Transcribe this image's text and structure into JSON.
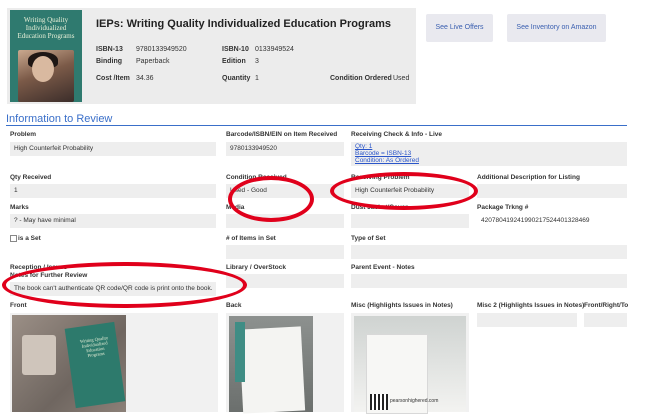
{
  "book": {
    "title": "IEPs: Writing Quality Individualized Education Programs",
    "cover_text": "Writing Quality Individualized Education Programs",
    "isbn13_label": "ISBN-13",
    "isbn13": "9780133949520",
    "isbn10_label": "ISBN-10",
    "isbn10": "0133949524",
    "binding_label": "Binding",
    "binding": "Paperback",
    "edition_label": "Edition",
    "edition": "3",
    "cost_label": "Cost /Item",
    "cost": "34.36",
    "quantity_label": "Quantity",
    "quantity": "1",
    "condition_label": "Condition Ordered",
    "condition": "Used"
  },
  "buttons": {
    "live_offers": "See Live Offers",
    "inventory": "See Inventory on Amazon"
  },
  "section": {
    "title": "Information to Review"
  },
  "fields": {
    "problem_label": "Problem",
    "problem": "High Counterfeit Probability",
    "barcode_label": "Barcode/ISBN/EIN on Item Received",
    "barcode": "9780133949520",
    "check_label": "Receiving Check & Info - Live",
    "check_qty": "Qty: 1",
    "check_barcode": "Barcode = ISBN-13",
    "check_condition": "Condition: As Ordered",
    "qty_label": "Qty Received",
    "qty": "1",
    "cond_label": "Condition Received",
    "cond": "Used - Good",
    "recv_problem_label": "Receiving Problem",
    "recv_problem": "High Counterfeit Probability",
    "addl_label": "Additional Description for Listing",
    "marks_label": "Marks",
    "marks": "? - May have minimal",
    "media_label": "Media",
    "jacket_label": "Dust Jacket/Cover",
    "tracking_label": "Package Trkng #",
    "tracking": "420780419241990217524401328469",
    "set_label": "is a Set",
    "items_label": "# of Items in Set",
    "type_label": "Type of Set",
    "reception_label": "Reception / Issues",
    "library_label": "Library / OverStock",
    "parent_label": "Parent Event - Notes",
    "further_label": "Notes for Further Review",
    "further": "The book can't authenticate QR code/QR code is print onto the book.",
    "front_label": "Front",
    "back_label": "Back",
    "misc_label": "Misc (Highlights Issues in Notes)",
    "misc2_label": "Misc 2  (Highlights Issues in Notes)",
    "frontrighttop_label": "Front/Right/To",
    "photo_caption": "pearsonhighered.com",
    "photo_cover_text": "Writing Quality Individualized Education Programs"
  },
  "colors": {
    "accent": "#3a6fc9",
    "annotation": "#e0001b",
    "field_bg": "#eeeeee"
  }
}
